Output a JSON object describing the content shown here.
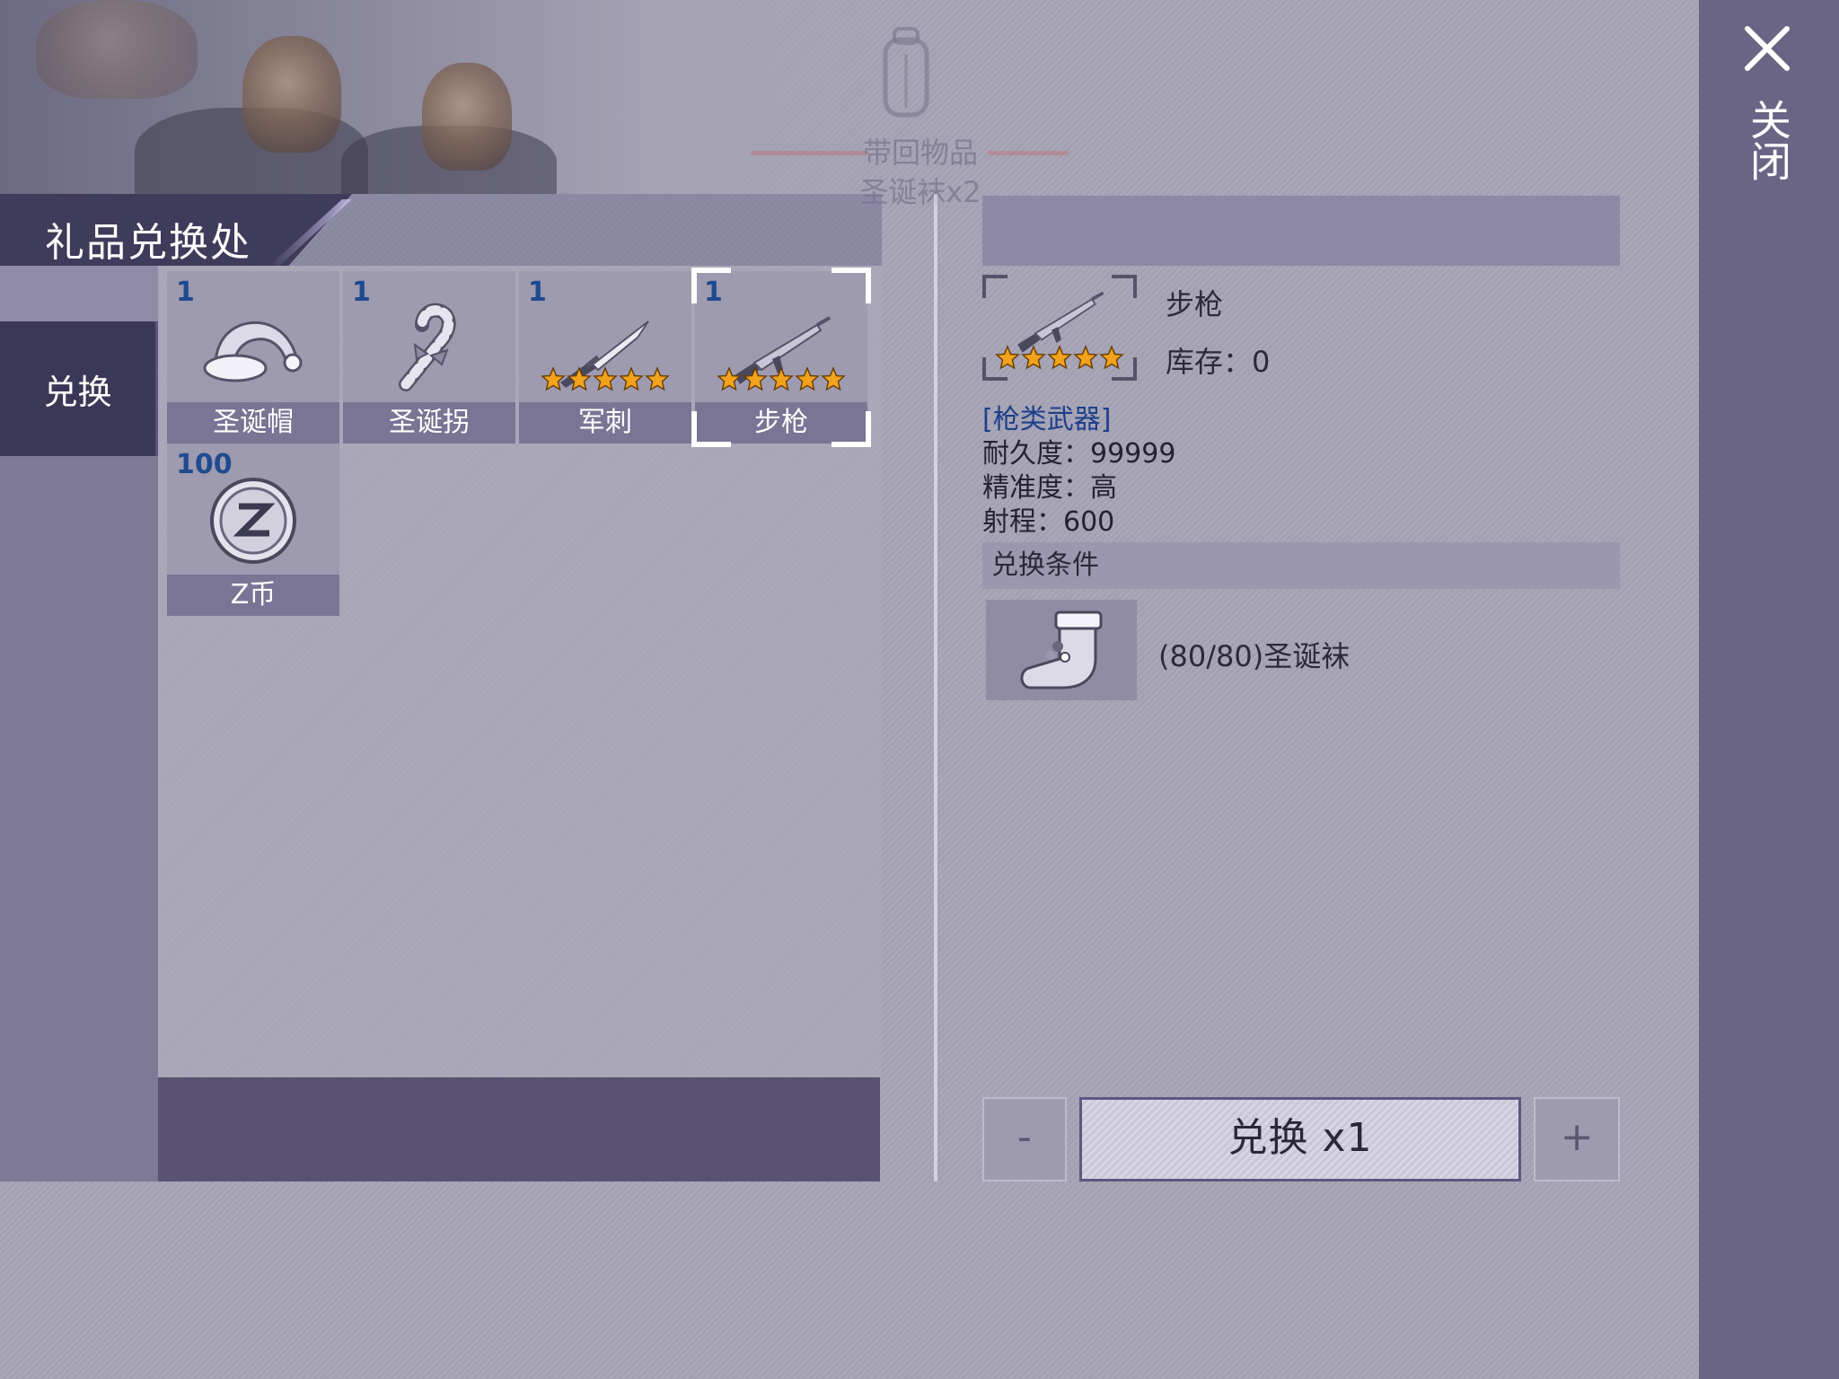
{
  "banner": {
    "line1": "带回物品",
    "line2": "圣诞袜x2"
  },
  "title": "礼品兑换处",
  "sidebar": {
    "tabs": [
      {
        "label": "兑换",
        "active": true
      }
    ]
  },
  "items": [
    {
      "qty": "1",
      "name": "圣诞帽",
      "icon": "santa-hat-icon",
      "stars": 0
    },
    {
      "qty": "1",
      "name": "圣诞拐",
      "icon": "candy-cane-icon",
      "stars": 0
    },
    {
      "qty": "1",
      "name": "军刺",
      "icon": "bayonet-icon",
      "stars": 5
    },
    {
      "qty": "1",
      "name": "步枪",
      "icon": "rifle-icon",
      "stars": 5,
      "selected": true
    },
    {
      "qty": "100",
      "name": "Z币",
      "icon": "z-coin-icon",
      "stars": 0
    }
  ],
  "detail": {
    "name": "步枪",
    "stock_label": "库存：",
    "stock_value": "0",
    "stars": 5,
    "category": "[枪类武器]",
    "stats": [
      "耐久度：99999",
      "精准度：高",
      "射程：600"
    ],
    "condition_header": "兑换条件",
    "condition_item_icon": "christmas-stocking-icon",
    "condition_text": "(80/80)圣诞袜"
  },
  "buttons": {
    "minus": "-",
    "exchange": "兑换 x1",
    "plus": "+"
  },
  "close_label": "关闭",
  "colors": {
    "panel_dark": "#3b3756",
    "accent_blue": "#1f4b8f",
    "star_gold": "#f2a31b",
    "close_strip": "#6b6585"
  }
}
